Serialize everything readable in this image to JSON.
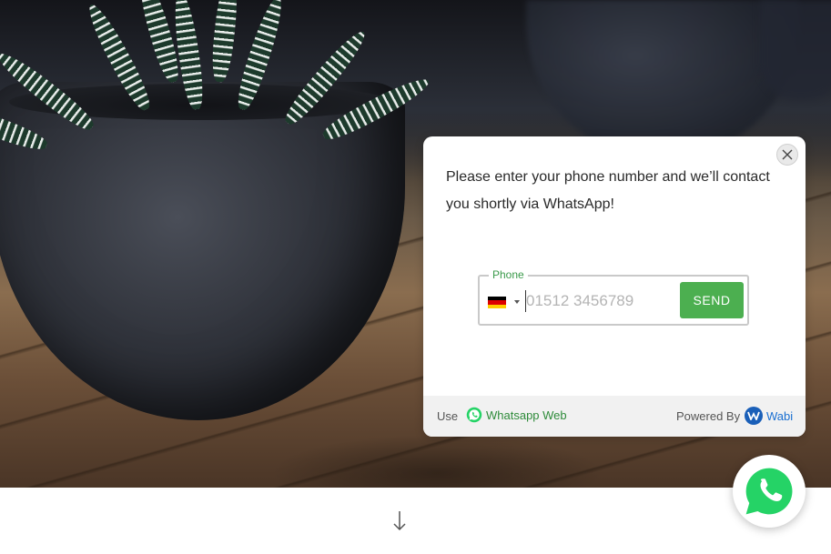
{
  "widget": {
    "prompt": "Please enter your phone number and we’ll contact you shortly via WhatsApp!",
    "phone_label": "Phone",
    "phone_placeholder": "01512 3456789",
    "phone_value": "",
    "country": "Germany",
    "send_label": "SEND",
    "footer": {
      "use_label": "Use",
      "whatsapp_web_label": "Whatsapp Web",
      "powered_by_label": "Powered By",
      "brand_label": "Wabi"
    }
  },
  "icons": {
    "close": "close-icon",
    "flag": "germany-flag-icon",
    "dropdown": "chevron-down-icon",
    "whatsapp": "whatsapp-icon",
    "wabi_logo": "wabi-logo-icon",
    "scroll_down": "arrow-down-icon"
  },
  "colors": {
    "accent_green": "#4caf50",
    "link_green": "#2e8b3a",
    "wabi_blue": "#1a6fd1",
    "whatsapp_green": "#25d366"
  }
}
